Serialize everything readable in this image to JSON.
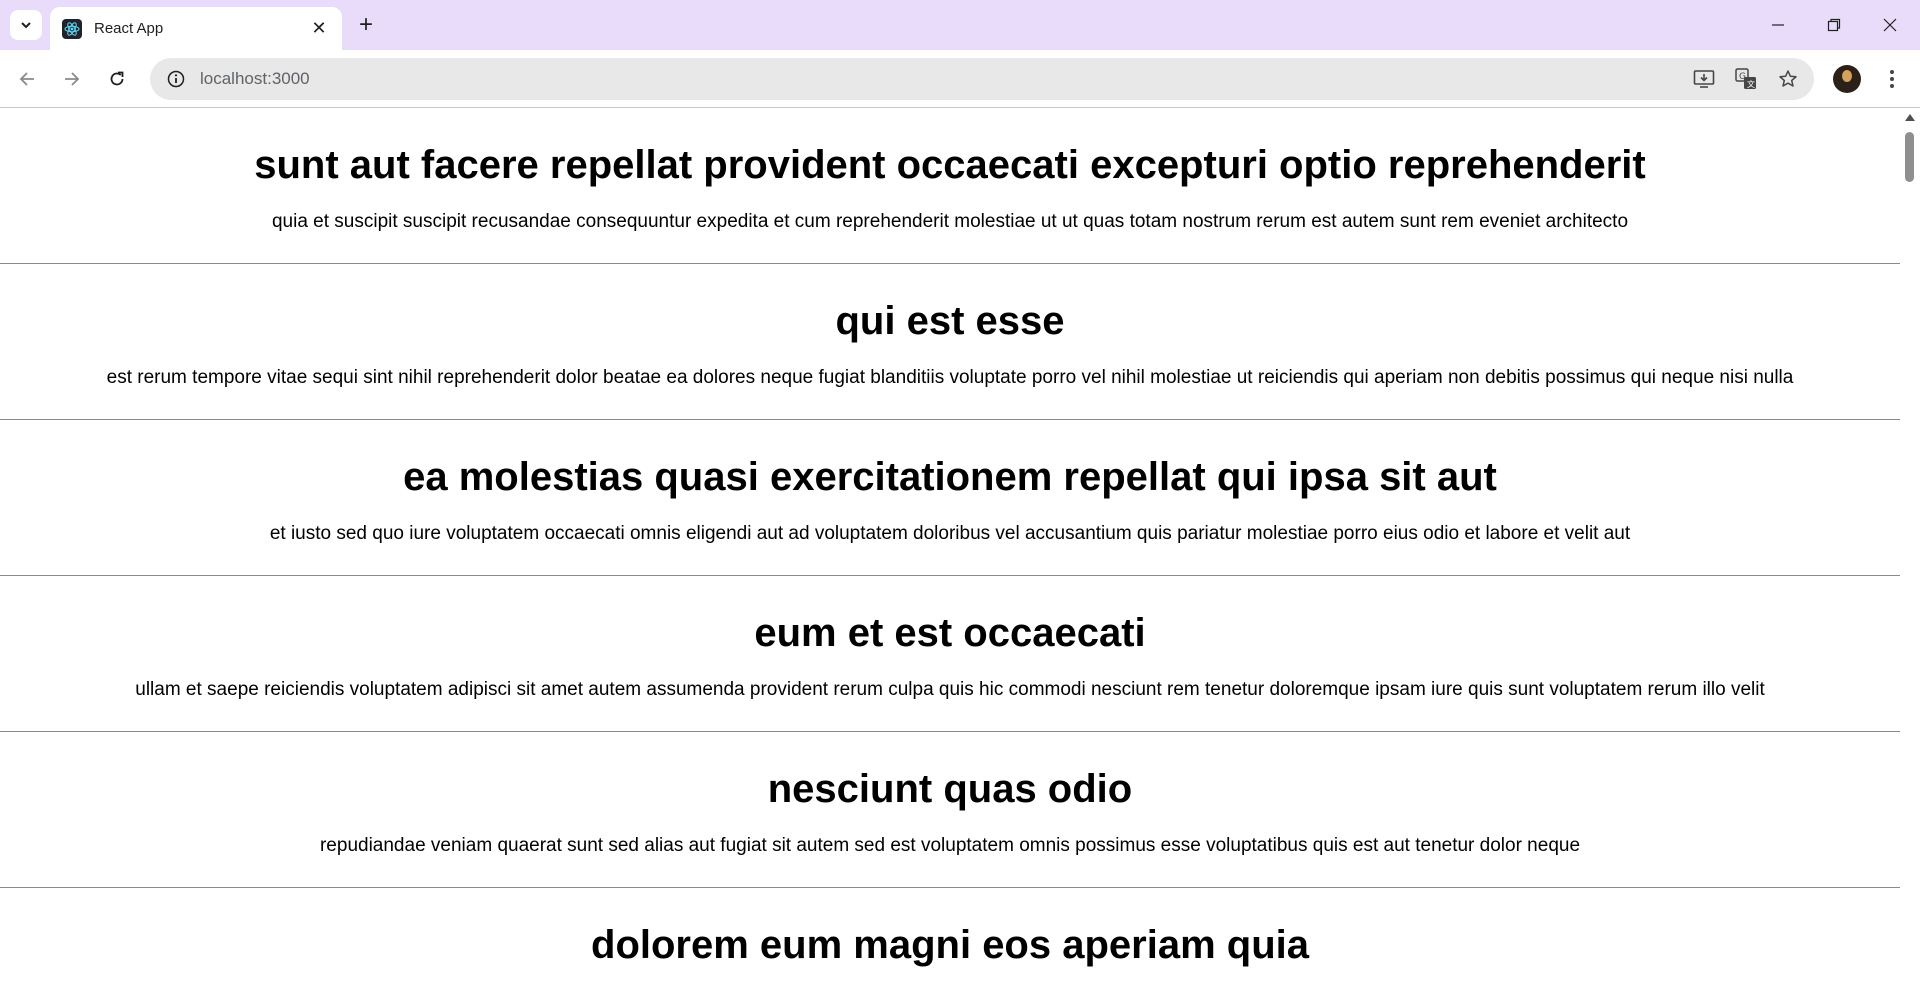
{
  "browser": {
    "tab_title": "React App",
    "url": "localhost:3000",
    "new_tab_glyph": "+",
    "close_glyph": "✕"
  },
  "icons": [
    "tab-search-icon",
    "react-favicon-icon",
    "close-icon",
    "new-tab-icon",
    "minimize-icon",
    "restore-icon",
    "window-close-icon",
    "back-icon",
    "forward-icon",
    "reload-icon",
    "site-info-icon",
    "install-app-icon",
    "translate-icon",
    "bookmark-star-icon",
    "profile-avatar",
    "menu-kebab-icon"
  ],
  "posts": [
    {
      "title": "sunt aut facere repellat provident occaecati excepturi optio reprehenderit",
      "body": "quia et suscipit suscipit recusandae consequuntur expedita et cum reprehenderit molestiae ut ut quas totam nostrum rerum est autem sunt rem eveniet architecto"
    },
    {
      "title": "qui est esse",
      "body": "est rerum tempore vitae sequi sint nihil reprehenderit dolor beatae ea dolores neque fugiat blanditiis voluptate porro vel nihil molestiae ut reiciendis qui aperiam non debitis possimus qui neque nisi nulla"
    },
    {
      "title": "ea molestias quasi exercitationem repellat qui ipsa sit aut",
      "body": "et iusto sed quo iure voluptatem occaecati omnis eligendi aut ad voluptatem doloribus vel accusantium quis pariatur molestiae porro eius odio et labore et velit aut"
    },
    {
      "title": "eum et est occaecati",
      "body": "ullam et saepe reiciendis voluptatem adipisci sit amet autem assumenda provident rerum culpa quis hic commodi nesciunt rem tenetur doloremque ipsam iure quis sunt voluptatem rerum illo velit"
    },
    {
      "title": "nesciunt quas odio",
      "body": "repudiandae veniam quaerat sunt sed alias aut fugiat sit autem sed est voluptatem omnis possimus esse voluptatibus quis est aut tenetur dolor neque"
    },
    {
      "title": "dolorem eum magni eos aperiam quia",
      "body": ""
    }
  ]
}
